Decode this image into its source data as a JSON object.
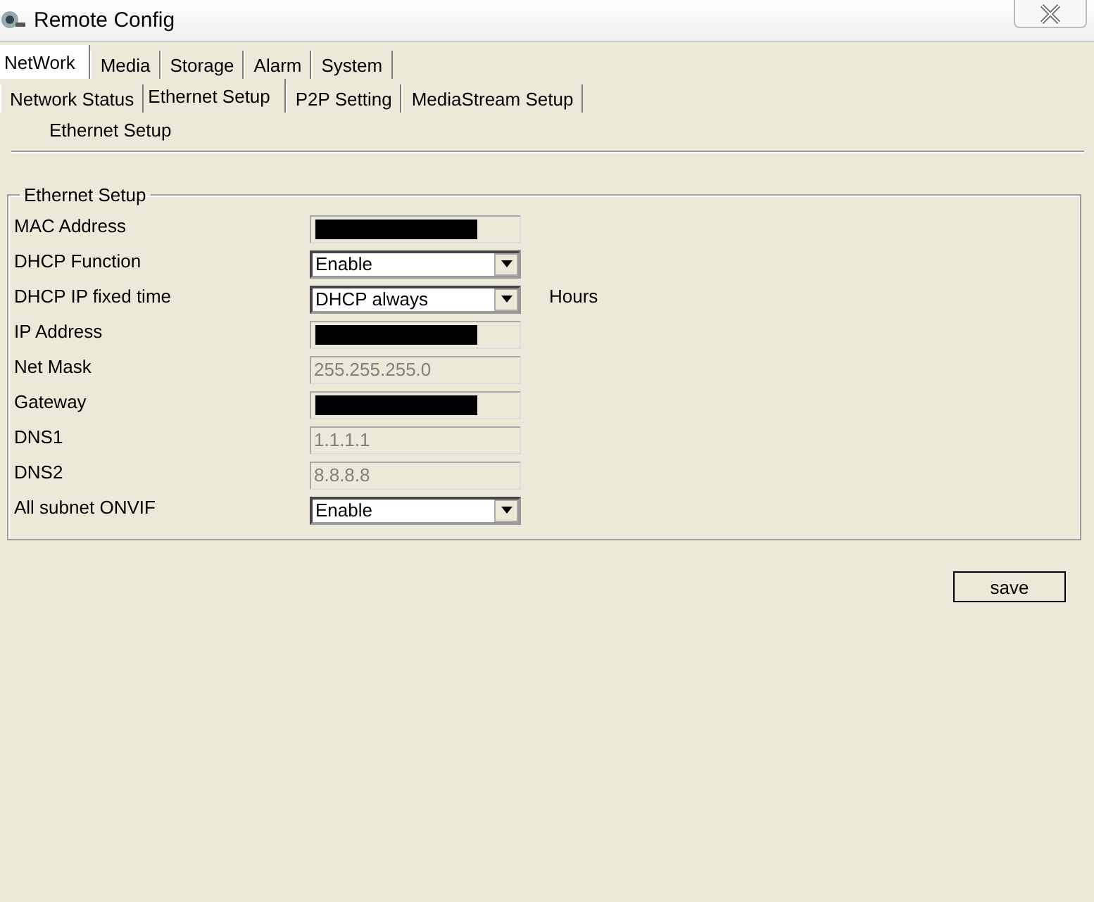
{
  "window": {
    "title": "Remote Config"
  },
  "tabs": [
    {
      "label": "NetWork",
      "selected": true
    },
    {
      "label": "Media",
      "selected": false
    },
    {
      "label": "Storage",
      "selected": false
    },
    {
      "label": "Alarm",
      "selected": false
    },
    {
      "label": "System",
      "selected": false
    }
  ],
  "subtabs": [
    {
      "label": "Network Status",
      "selected": false
    },
    {
      "label": "Ethernet Setup",
      "selected": true
    },
    {
      "label": "P2P Setting",
      "selected": false
    },
    {
      "label": "MediaStream Setup",
      "selected": false
    }
  ],
  "section_title": "Ethernet Setup",
  "group": {
    "title": "Ethernet Setup",
    "fields": [
      {
        "label": "MAC Address",
        "kind": "redacted",
        "disabled": true
      },
      {
        "label": "DHCP Function",
        "kind": "select",
        "value": "Enable",
        "disabled": false
      },
      {
        "label": "DHCP IP fixed time",
        "kind": "select",
        "value": "DHCP always",
        "disabled": false,
        "unit": "Hours"
      },
      {
        "label": "IP Address",
        "kind": "redacted",
        "disabled": true
      },
      {
        "label": "Net Mask",
        "kind": "text",
        "value": "255.255.255.0",
        "disabled": true
      },
      {
        "label": "Gateway",
        "kind": "redacted",
        "disabled": true
      },
      {
        "label": "DNS1",
        "kind": "text",
        "value": "1.1.1.1",
        "disabled": true
      },
      {
        "label": "DNS2",
        "kind": "text",
        "value": "8.8.8.8",
        "disabled": true
      },
      {
        "label": "All subnet ONVIF",
        "kind": "select",
        "value": "Enable",
        "disabled": false
      }
    ]
  },
  "buttons": [
    "save"
  ]
}
